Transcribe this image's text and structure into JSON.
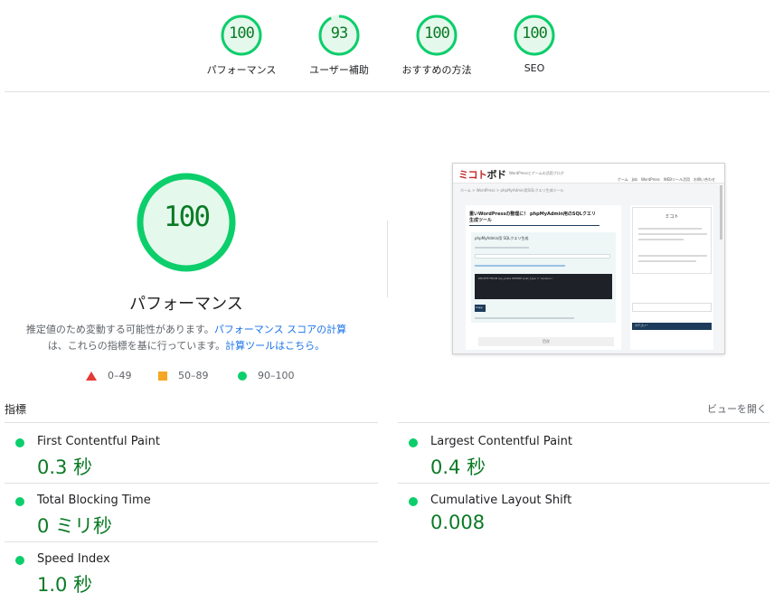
{
  "categories": [
    {
      "score": "100",
      "label": "パフォーマンス",
      "fraction": 1.0
    },
    {
      "score": "93",
      "label": "ユーザー補助",
      "fraction": 0.93
    },
    {
      "score": "100",
      "label": "おすすめの方法",
      "fraction": 1.0
    },
    {
      "score": "100",
      "label": "SEO",
      "fraction": 1.0
    }
  ],
  "main": {
    "score": "100",
    "fraction": 1.0,
    "title": "パフォーマンス",
    "desc_prefix": "推定値のため変動する可能性があります。",
    "desc_link1": "パフォーマンス スコアの計算",
    "desc_mid": "は、これらの指標を基に行っています。",
    "desc_link2": "計算ツールはこちら。"
  },
  "legend": [
    {
      "shape": "triangle",
      "range": "0–49",
      "color": "#e53935"
    },
    {
      "shape": "square",
      "range": "50–89",
      "color": "#f5a623"
    },
    {
      "shape": "circle",
      "range": "90–100",
      "color": "#0cce6b"
    }
  ],
  "thumbnail": {
    "logo_red": "ミコト",
    "logo_dark": "ボド",
    "tagline": "WordPressとゲームの活用ブログ",
    "nav": "ゲーム　Job　WordPress　WEBツール活用　お問い合わせ",
    "breadcrumb": "ホーム > WordPress > phpMyAdmin用SQLクエリ生成ツール",
    "title": "重いWordPressの整理に！ phpMyAdmin用のSQLクエリ生成ツール",
    "box_heading": "phpMyAdmin用 SQLクエリ生成",
    "code_text": "DELETE FROM wp_posts WHERE post_type = 'revision';",
    "button": "Copy",
    "footer": "目次",
    "side_title": "ミコト",
    "side_category": "カテゴリー"
  },
  "metrics": {
    "section_label": "指標",
    "toggle": "ビューを開く",
    "items": [
      {
        "name": "First Contentful Paint",
        "value": "0.3 秒"
      },
      {
        "name": "Largest Contentful Paint",
        "value": "0.4 秒"
      },
      {
        "name": "Total Blocking Time",
        "value": "0 ミリ秒"
      },
      {
        "name": "Cumulative Layout Shift",
        "value": "0.008"
      },
      {
        "name": "Speed Index",
        "value": "1.0 秒"
      }
    ]
  },
  "colors": {
    "pass_green": "#0cce6b",
    "pass_text": "#0a7a25",
    "ring_bg": "#e5f8ec",
    "link": "#1a73e8"
  }
}
